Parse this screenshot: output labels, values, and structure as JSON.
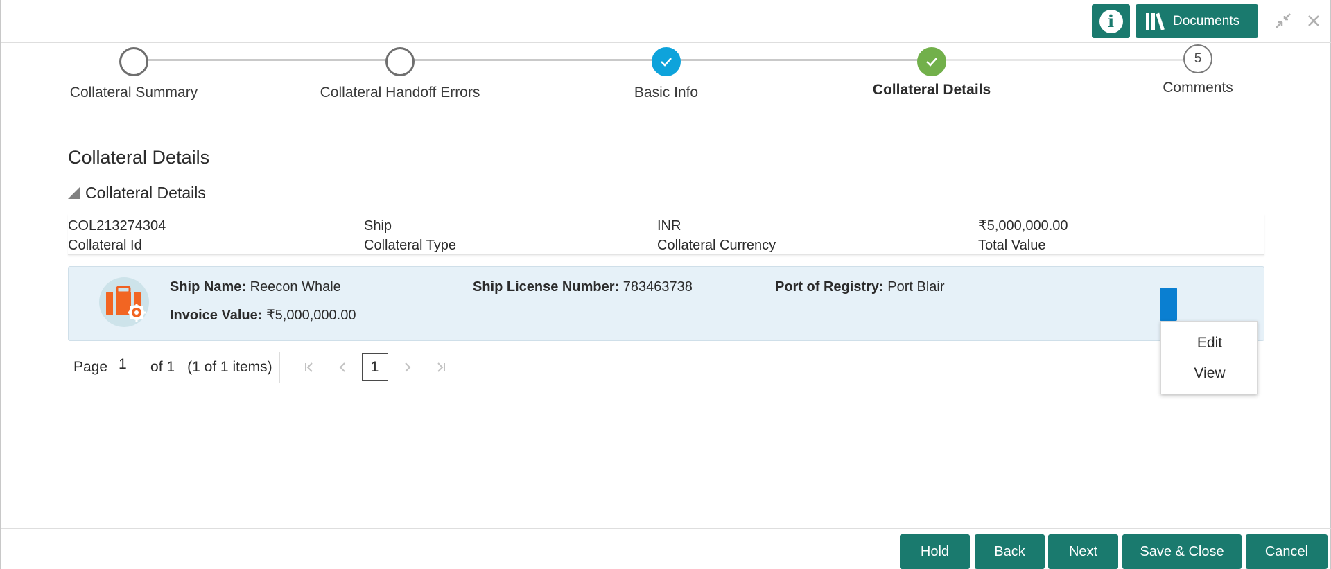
{
  "header": {
    "documents_label": "Documents",
    "info_glyph": "i"
  },
  "stepper": {
    "steps": [
      {
        "label": "Collateral Summary",
        "state": "pending",
        "number": ""
      },
      {
        "label": "Collateral Handoff Errors",
        "state": "pending",
        "number": ""
      },
      {
        "label": "Basic Info",
        "state": "done-blue",
        "number": ""
      },
      {
        "label": "Collateral Details",
        "state": "done-green-active",
        "number": ""
      },
      {
        "label": "Comments",
        "state": "pending",
        "number": "5"
      }
    ],
    "colors": {
      "blue": "#0ea3db",
      "green": "#72b04b",
      "line": "#c9c9c9",
      "active_line": "#8a8a8a"
    }
  },
  "main": {
    "page_title": "Collateral Details",
    "section_title": "Collateral Details",
    "summary": [
      {
        "value": "COL213274304",
        "caption": "Collateral Id"
      },
      {
        "value": "Ship",
        "caption": "Collateral Type"
      },
      {
        "value": "INR",
        "caption": "Collateral Currency"
      },
      {
        "value": "₹5,000,000.00",
        "caption": "Total Value"
      }
    ],
    "card": {
      "ship_name_label": "Ship Name:",
      "ship_name": "Reecon Whale",
      "license_label": "Ship License Number:",
      "license": "783463738",
      "port_label": "Port of Registry:",
      "port": "Port Blair",
      "invoice_label": "Invoice Value:",
      "invoice": "₹5,000,000.00",
      "icon": "briefcase-gear-icon",
      "card_color": "#e6f1f8",
      "kebab_color": "#0a7fd1"
    },
    "menu": {
      "items": [
        "Edit",
        "View"
      ]
    },
    "pagination": {
      "page_label": "Page",
      "page_value": "1",
      "of_label": "of 1",
      "items_label": "(1 of 1 items)",
      "current": "1"
    }
  },
  "footer": {
    "buttons": [
      "Hold",
      "Back",
      "Next",
      "Save & Close",
      "Cancel"
    ],
    "button_color": "#1a7a6e"
  }
}
